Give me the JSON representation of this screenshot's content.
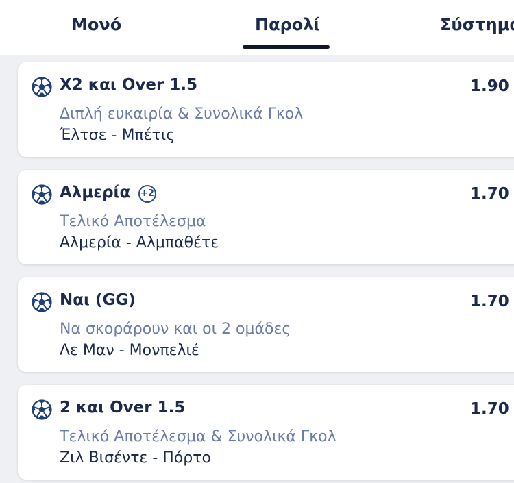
{
  "tabs": [
    {
      "label": "Μονό"
    },
    {
      "label": "Παρολί"
    },
    {
      "label": "Σύστημα"
    }
  ],
  "selections": [
    {
      "icon": "soccer-ball-icon",
      "name": "X2 και Over 1.5",
      "odds": "1.90",
      "market": "Διπλή ευκαιρία & Συνολικά Γκολ",
      "match": "Έλτσε - Μπέτις"
    },
    {
      "icon": "soccer-ball-icon",
      "name": "Αλμερία",
      "badge": "+2",
      "odds": "1.70",
      "market": "Τελικό Αποτέλεσμα",
      "match": "Αλμερία - Αλμπαθέτε"
    },
    {
      "icon": "soccer-ball-icon",
      "name": "Ναι (GG)",
      "odds": "1.70",
      "market": "Να σκοράρουν και οι 2 ομάδες",
      "match": "Λε Μαν - Μονπελιέ"
    },
    {
      "icon": "soccer-ball-icon",
      "name": "2 και Over 1.5",
      "odds": "1.70",
      "market": "Τελικό Αποτέλεσμα & Συνολικά Γκολ",
      "match": "Ζιλ Βισέντε - Πόρτο"
    }
  ]
}
